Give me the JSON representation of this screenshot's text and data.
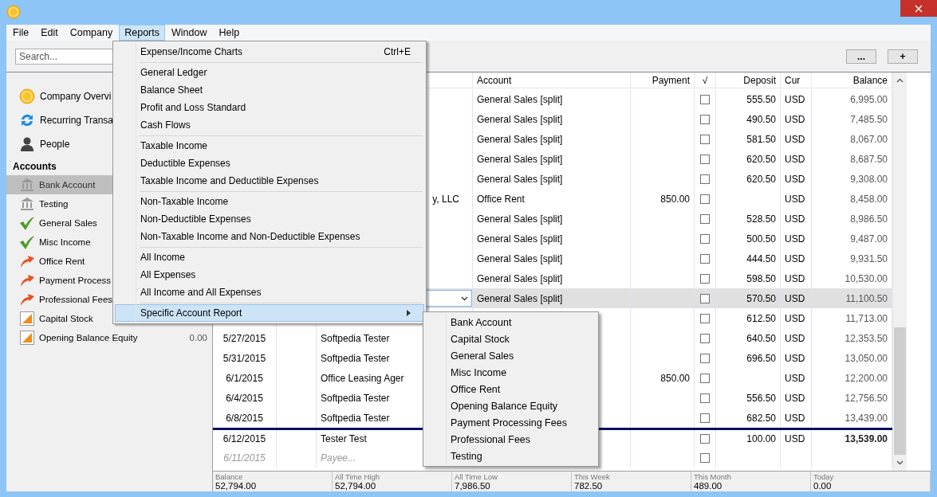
{
  "menubar": [
    {
      "label": "File",
      "selected": false
    },
    {
      "label": "Edit",
      "selected": false
    },
    {
      "label": "Company",
      "selected": false
    },
    {
      "label": "Reports",
      "selected": true
    },
    {
      "label": "Window",
      "selected": false
    },
    {
      "label": "Help",
      "selected": false
    }
  ],
  "search": {
    "placeholder": "Search..."
  },
  "toolbar_buttons": [
    "...",
    "+"
  ],
  "sidebar": {
    "items": [
      {
        "label": "Company Overvi",
        "kind": "overview"
      },
      {
        "label": "Recurring Transa",
        "kind": "recurring"
      },
      {
        "label": "People",
        "kind": "people"
      }
    ],
    "accounts_heading": "Accounts",
    "accounts": [
      {
        "label": "Bank Account",
        "kind": "bank",
        "selected": true
      },
      {
        "label": "Testing",
        "kind": "bank",
        "selected": false
      },
      {
        "label": "General Sales",
        "kind": "income",
        "selected": false
      },
      {
        "label": "Misc Income",
        "kind": "income",
        "selected": false
      },
      {
        "label": "Office Rent",
        "kind": "expense",
        "selected": false
      },
      {
        "label": "Payment Process",
        "kind": "expense",
        "selected": false
      },
      {
        "label": "Professional Fees",
        "kind": "expense",
        "selected": false
      },
      {
        "label": "Capital Stock",
        "kind": "equity",
        "selected": false
      },
      {
        "label": "Opening Balance Equity",
        "kind": "equity",
        "selected": false,
        "balance": "0.00"
      }
    ]
  },
  "table": {
    "columns": [
      "Account",
      "Payment",
      "√",
      "Deposit",
      "Cur",
      "Balance"
    ],
    "rows": [
      {
        "account": "General Sales [split]",
        "cleared": false,
        "deposit": "555.50",
        "cur": "USD",
        "balance": "6,995.00"
      },
      {
        "account": "General Sales [split]",
        "cleared": false,
        "deposit": "490.50",
        "cur": "USD",
        "balance": "7,485.50"
      },
      {
        "account": "General Sales [split]",
        "cleared": false,
        "deposit": "581.50",
        "cur": "USD",
        "balance": "8,067.00"
      },
      {
        "account": "General Sales [split]",
        "cleared": false,
        "deposit": "620.50",
        "cur": "USD",
        "balance": "8,687.50"
      },
      {
        "account": "General Sales [split]",
        "cleared": false,
        "deposit": "620.50",
        "cur": "USD",
        "balance": "9,308.00"
      },
      {
        "payee": "y, LLC",
        "payee_clipped": true,
        "account": "Office Rent",
        "payment": "850.00",
        "cleared": false,
        "cur": "USD",
        "balance": "8,458.00"
      },
      {
        "account": "General Sales [split]",
        "cleared": false,
        "deposit": "528.50",
        "cur": "USD",
        "balance": "8,986.50"
      },
      {
        "account": "General Sales [split]",
        "cleared": false,
        "deposit": "500.50",
        "cur": "USD",
        "balance": "9,487.00"
      },
      {
        "account": "General Sales [split]",
        "cleared": false,
        "deposit": "444.50",
        "cur": "USD",
        "balance": "9,931.50"
      },
      {
        "account": "General Sales [split]",
        "cleared": false,
        "deposit": "598.50",
        "cur": "USD",
        "balance": "10,530.00"
      },
      {
        "selected": true,
        "editing": true,
        "account": "General Sales [split]",
        "cleared": false,
        "deposit": "570.50",
        "cur": "USD",
        "balance": "11,100.50"
      },
      {
        "cleared": false,
        "deposit": "612.50",
        "cur": "USD",
        "balance": "11,713.00"
      },
      {
        "date": "5/27/2015",
        "payee": "Softpedia Tester",
        "cleared": false,
        "deposit": "640.50",
        "cur": "USD",
        "balance": "12,353.50"
      },
      {
        "date": "5/31/2015",
        "payee": "Softpedia Tester",
        "cleared": false,
        "deposit": "696.50",
        "cur": "USD",
        "balance": "13,050.00"
      },
      {
        "date": "6/1/2015",
        "payee": "Office Leasing Ager",
        "payment": "850.00",
        "cleared": false,
        "cur": "USD",
        "balance": "12,200.00"
      },
      {
        "date": "6/4/2015",
        "payee": "Softpedia Tester",
        "cleared": false,
        "deposit": "556.50",
        "cur": "USD",
        "balance": "12,756.50"
      },
      {
        "date": "6/8/2015",
        "payee": "Softpedia Tester",
        "cleared": false,
        "deposit": "682.50",
        "cur": "USD",
        "balance": "13,439.00"
      },
      {
        "divider_above": true,
        "bold": true,
        "date": "6/12/2015",
        "payee": "Tester Test",
        "cleared": false,
        "deposit": "100.00",
        "cur": "USD",
        "balance": "13,539.00"
      },
      {
        "kind": "new",
        "date": "6/11/2015",
        "payee": "Payee...",
        "cleared": false
      }
    ]
  },
  "summary": [
    {
      "label": "Balance",
      "value": "52,794.00"
    },
    {
      "label": "All Time High",
      "value": "52,794.00"
    },
    {
      "label": "All Time Low",
      "value": "7,986.50"
    },
    {
      "label": "This Week",
      "value": "782.50"
    },
    {
      "label": "This Month",
      "value": "489.00"
    },
    {
      "label": "Today",
      "value": "0.00"
    }
  ],
  "reports_menu": {
    "groups": [
      [
        {
          "label": "Expense/Income Charts",
          "shortcut": "Ctrl+E",
          "selected": false
        }
      ],
      [
        {
          "label": "General Ledger",
          "selected": false
        },
        {
          "label": "Balance Sheet",
          "selected": false
        },
        {
          "label": "Profit and Loss Standard",
          "selected": false
        },
        {
          "label": "Cash Flows",
          "selected": false
        }
      ],
      [
        {
          "label": "Taxable Income",
          "selected": false
        },
        {
          "label": "Deductible Expenses",
          "selected": false
        },
        {
          "label": "Taxable Income and Deductible Expenses",
          "selected": false
        }
      ],
      [
        {
          "label": "Non-Taxable Income",
          "selected": false
        },
        {
          "label": "Non-Deductible Expenses",
          "selected": false
        },
        {
          "label": "Non-Taxable Income and Non-Deductible Expenses",
          "selected": false
        }
      ],
      [
        {
          "label": "All Income",
          "selected": false
        },
        {
          "label": "All Expenses",
          "selected": false
        },
        {
          "label": "All Income and All Expenses",
          "selected": false
        }
      ],
      [
        {
          "label": "Specific Account Report",
          "selected": true,
          "submenu": true
        }
      ]
    ]
  },
  "submenu": {
    "items": [
      "Bank Account",
      "Capital Stock",
      "General Sales",
      "Misc Income",
      "Office Rent",
      "Opening Balance Equity",
      "Payment Processing Fees",
      "Professional Fees",
      "Testing"
    ]
  }
}
